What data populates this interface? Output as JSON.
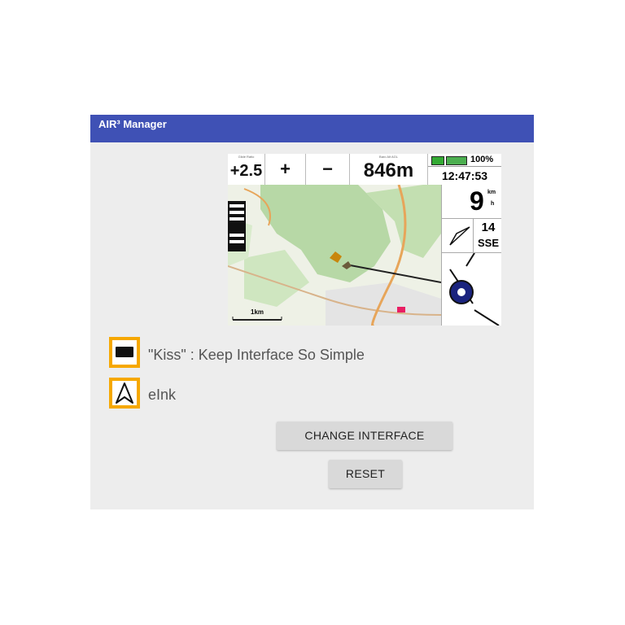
{
  "window": {
    "title": "AIR³ Manager"
  },
  "preview": {
    "vario_value": "+2.5",
    "plus_label": "+",
    "minus_label": "−",
    "altitude_value": "846m",
    "battery_pct": "100%",
    "clock": "12:47:53",
    "speed_value": "9",
    "speed_unit_top": "km",
    "speed_unit_bottom": "h",
    "wind_speed": "14",
    "wind_dir": "SSE",
    "scale_label": "1km"
  },
  "options": [
    {
      "label": "\"Kiss\" : Keep Interface So Simple",
      "icon": "rectangle-icon"
    },
    {
      "label": "eInk",
      "icon": "navigation-arrow-icon"
    }
  ],
  "buttons": {
    "change_interface": "CHANGE INTERFACE",
    "reset": "RESET"
  },
  "colors": {
    "titlebar": "#3f51b5",
    "option_border": "#f6a800",
    "background": "#ededed"
  }
}
